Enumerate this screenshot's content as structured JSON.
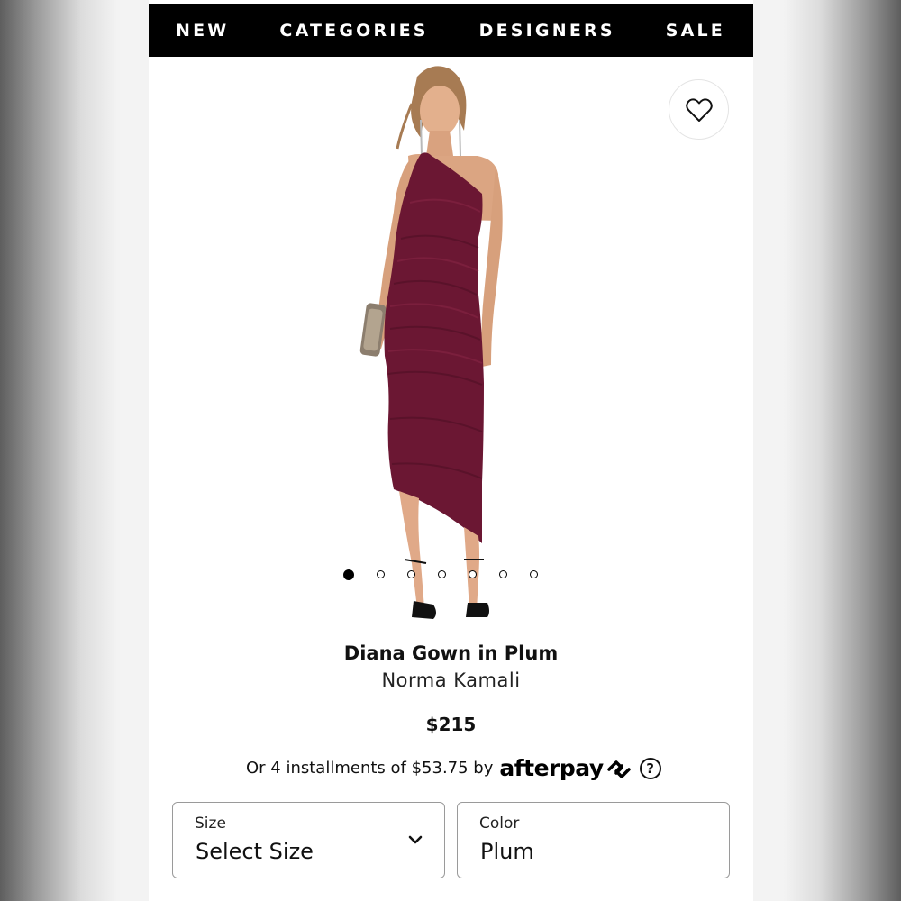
{
  "nav": {
    "items": [
      "NEW",
      "CATEGORIES",
      "DESIGNERS",
      "SALE"
    ]
  },
  "product": {
    "title": "Diana Gown in Plum",
    "brand": "Norma Kamali",
    "price": "$215",
    "color_swatch": "#6b1733"
  },
  "gallery": {
    "image_count": 7,
    "active_index": 0
  },
  "payment": {
    "installments_text": "Or 4 installments of $53.75 by",
    "provider": "afterpay",
    "help_symbol": "?"
  },
  "size_select": {
    "label": "Size",
    "value": "Select Size"
  },
  "color_select": {
    "label": "Color",
    "value": "Plum"
  },
  "icons": {
    "favorite": "heart-icon",
    "dropdown": "chevron-down-icon",
    "afterpay_logo": "afterpay-logo-icon"
  }
}
